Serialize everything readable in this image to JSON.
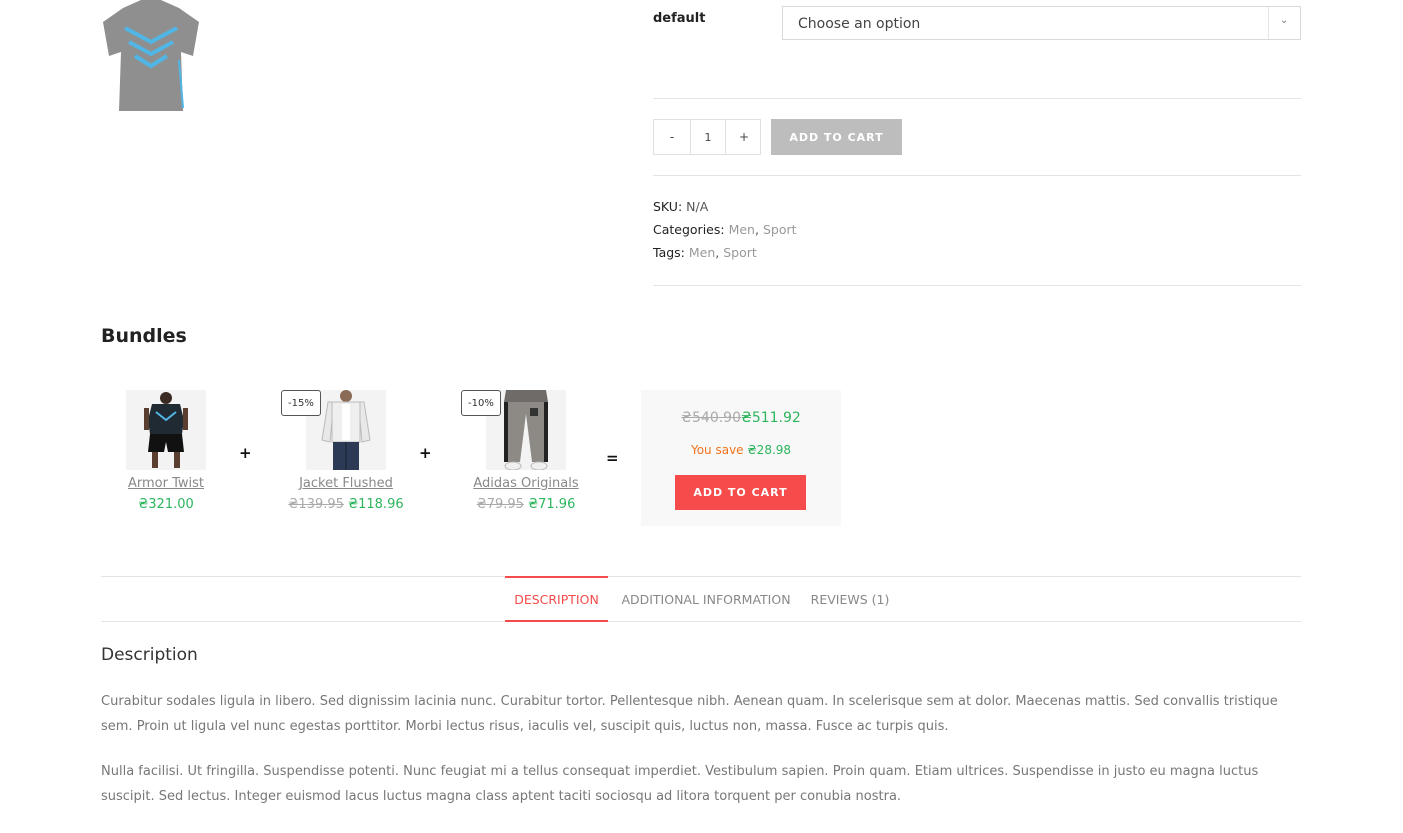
{
  "product": {
    "variation_label": "default",
    "variation_select_value": "Choose an option",
    "quantity": {
      "minus": "-",
      "value": "1",
      "plus": "+"
    },
    "add_to_cart_label": "ADD TO CART",
    "sku_label": "SKU:",
    "sku_value": "N/A",
    "categories_label": "Categories:",
    "categories": [
      "Men",
      "Sport"
    ],
    "tags_label": "Tags:",
    "tags": [
      "Men",
      "Sport"
    ],
    "separator": ","
  },
  "bundles": {
    "title": "Bundles",
    "plus": "+",
    "equals": "=",
    "items": [
      {
        "name": "Armor Twist",
        "old_price": "",
        "price": "₴321.00",
        "badge": ""
      },
      {
        "name": "Jacket Flushed",
        "old_price": "₴139.95",
        "price": "₴118.96",
        "badge": "-15%"
      },
      {
        "name": "Adidas Originals",
        "old_price": "₴79.95",
        "price": "₴71.96",
        "badge": "-10%"
      }
    ],
    "total_old": "₴540.90",
    "total_new": "₴511.92",
    "you_save_label": "You save",
    "you_save_amount": "₴28.98",
    "add_to_cart_label": "ADD TO CART"
  },
  "tabs": [
    {
      "label": "DESCRIPTION",
      "active": true
    },
    {
      "label": "ADDITIONAL INFORMATION",
      "active": false
    },
    {
      "label": "REVIEWS (1)",
      "active": false
    }
  ],
  "description": {
    "title": "Description",
    "paragraphs": [
      "Curabitur sodales ligula in libero. Sed dignissim lacinia nunc. Curabitur tortor. Pellentesque nibh. Aenean quam. In scelerisque sem at dolor. Maecenas mattis. Sed convallis tristique sem. Proin ut ligula vel nunc egestas porttitor. Morbi lectus risus, iaculis vel, suscipit quis, luctus non, massa. Fusce ac turpis quis.",
      "Nulla facilisi. Ut fringilla. Suspendisse potenti. Nunc feugiat mi a tellus consequat imperdiet. Vestibulum sapien. Proin quam. Etiam ultrices. Suspendisse in justo eu magna luctus suscipit. Sed lectus. Integer euismod lacus luctus magna class aptent taciti sociosqu ad litora torquent per conubia nostra."
    ]
  },
  "colors": {
    "accent_red": "#f54b4b",
    "price_green": "#2db55d",
    "save_orange": "#f0731e",
    "disabled_grey": "#bdbdbd"
  }
}
